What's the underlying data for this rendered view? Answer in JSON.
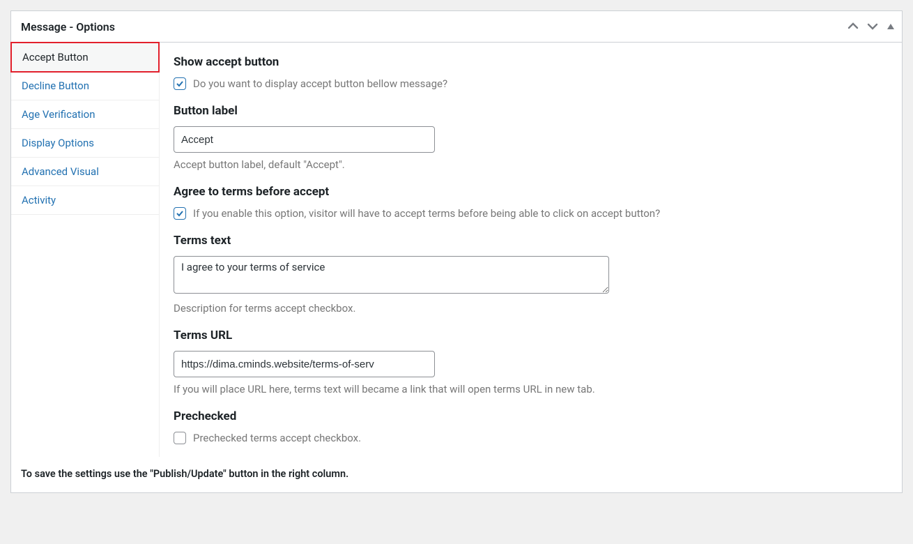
{
  "panel": {
    "title": "Message - Options"
  },
  "tabs": [
    {
      "label": "Accept Button",
      "active": true
    },
    {
      "label": "Decline Button",
      "active": false
    },
    {
      "label": "Age Verification",
      "active": false
    },
    {
      "label": "Display Options",
      "active": false
    },
    {
      "label": "Advanced Visual",
      "active": false
    },
    {
      "label": "Activity",
      "active": false
    }
  ],
  "sections": {
    "show_accept": {
      "title": "Show accept button",
      "label": "Do you want to display accept button bellow message?",
      "checked": true
    },
    "button_label": {
      "title": "Button label",
      "value": "Accept",
      "desc": "Accept button label, default \"Accept\"."
    },
    "agree_terms": {
      "title": "Agree to terms before accept",
      "label": "If you enable this option, visitor will have to accept terms before being able to click on accept button?",
      "checked": true
    },
    "terms_text": {
      "title": "Terms text",
      "value": "I agree to your terms of service",
      "desc": "Description for terms accept checkbox."
    },
    "terms_url": {
      "title": "Terms URL",
      "value": "https://dima.cminds.website/terms-of-serv",
      "desc": "If you will place URL here, terms text will became a link that will open terms URL in new tab."
    },
    "prechecked": {
      "title": "Prechecked",
      "label": "Prechecked terms accept checkbox.",
      "checked": false
    }
  },
  "footer": "To save the settings use the \"Publish/Update\" button in the right column."
}
